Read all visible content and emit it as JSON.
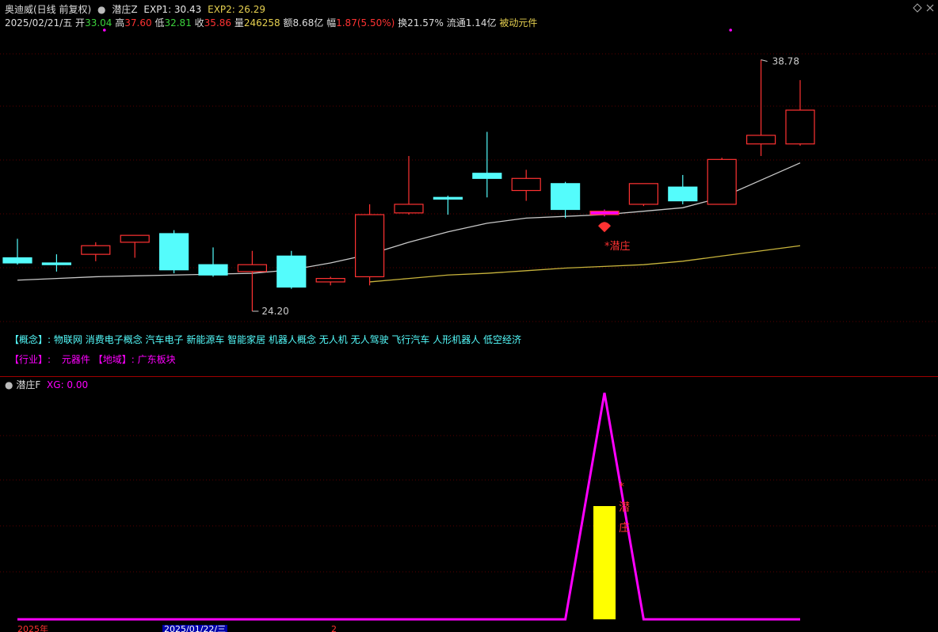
{
  "header": {
    "stock_title": "奥迪威(日线 前复权)",
    "indicator_name": "潜庄Z",
    "exp1_label": "EXP1: 30.43",
    "exp2_label": "EXP2: 26.29"
  },
  "ohlc_bar": {
    "date": "2025/02/21/五",
    "open_label": "开",
    "open": "33.04",
    "high_label": "高",
    "high": "37.60",
    "low_label": "低",
    "low": "32.81",
    "close_label": "收",
    "close": "35.86",
    "volume_label": "量",
    "volume": "246258",
    "amount_label": "额",
    "amount": "8.68亿",
    "change_label": "幅",
    "change": "1.87(5.50%)",
    "turnover_label": "换",
    "turnover": "21.57%",
    "float_label": "流通",
    "float": "1.14亿",
    "sector": "被动元件"
  },
  "info": {
    "concept_label": "【概念】:",
    "concepts": "物联网 消费电子概念 汽车电子 新能源车 智能家居 机器人概念 无人机 无人驾驶 飞行汽车 人形机器人 低空经济",
    "industry_label": "【行业】:",
    "industry": "元器件",
    "region_label": "【地域】:",
    "region": "广东板块"
  },
  "sub_header": {
    "name": "潜庄F",
    "xg_label": "XG: 0.00"
  },
  "bottom_axis": {
    "year_label": "2025年",
    "cursor_date": "2025/01/22/三",
    "marker": "2"
  },
  "colors": {
    "background": "#000000",
    "up": "#ff3232",
    "down": "#54fcfc",
    "signal": "#ff00ff",
    "ma1": "#c8c8c8",
    "ma2": "#c8b43c",
    "signal_bar": "#ffff00",
    "grid": "#5a0000"
  },
  "chart_data": [
    {
      "type": "candlestick",
      "price_range": [
        22.5,
        40.5
      ],
      "candles": [
        {
          "open": 27.3,
          "high": 28.4,
          "low": 26.9,
          "close": 27.0
        },
        {
          "open": 27.0,
          "high": 27.5,
          "low": 26.5,
          "close": 26.9
        },
        {
          "open": 27.5,
          "high": 28.2,
          "low": 27.1,
          "close": 28.0
        },
        {
          "open": 28.2,
          "high": 28.4,
          "low": 27.3,
          "close": 28.6
        },
        {
          "open": 28.7,
          "high": 28.9,
          "low": 26.4,
          "close": 26.6
        },
        {
          "open": 26.9,
          "high": 27.9,
          "low": 26.2,
          "close": 26.3
        },
        {
          "open": 26.5,
          "high": 27.7,
          "low": 24.2,
          "close": 26.9
        },
        {
          "open": 27.4,
          "high": 27.7,
          "low": 25.5,
          "close": 25.6
        },
        {
          "open": 25.9,
          "high": 26.2,
          "low": 25.7,
          "close": 26.1
        },
        {
          "open": 26.2,
          "high": 30.4,
          "low": 25.7,
          "close": 29.8
        },
        {
          "open": 29.9,
          "high": 33.2,
          "low": 29.8,
          "close": 30.4
        },
        {
          "open": 30.8,
          "high": 30.9,
          "low": 29.8,
          "close": 30.7
        },
        {
          "open": 32.2,
          "high": 34.6,
          "low": 30.8,
          "close": 31.9
        },
        {
          "open": 31.2,
          "high": 32.4,
          "low": 30.6,
          "close": 31.9
        },
        {
          "open": 31.6,
          "high": 31.7,
          "low": 29.6,
          "close": 30.1
        },
        {
          "open": 30.0,
          "high": 30.1,
          "low": 29.7,
          "close": 29.8
        },
        {
          "open": 30.4,
          "high": 31.6,
          "low": 30.3,
          "close": 31.6
        },
        {
          "open": 31.4,
          "high": 32.1,
          "low": 30.4,
          "close": 30.6
        },
        {
          "open": 30.4,
          "high": 33.1,
          "low": 30.4,
          "close": 33.0
        },
        {
          "open": 33.9,
          "high": 38.78,
          "low": 33.2,
          "close": 34.4
        },
        {
          "open": 33.9,
          "high": 37.6,
          "low": 33.8,
          "close": 35.86
        }
      ],
      "highlight_index": 15,
      "ma1": [
        26.0,
        26.1,
        26.2,
        26.25,
        26.3,
        26.35,
        26.4,
        26.6,
        27.0,
        27.5,
        28.2,
        28.8,
        29.3,
        29.6,
        29.7,
        29.8,
        30.0,
        30.2,
        30.8,
        31.8,
        32.8
      ],
      "ma2_start_index": 9,
      "ma2": [
        25.9,
        26.1,
        26.3,
        26.4,
        26.55,
        26.7,
        26.8,
        26.9,
        27.1,
        27.4,
        27.7,
        28.0
      ],
      "annotations": {
        "max_label": "38.78",
        "min_label": "24.20",
        "signal_label": "*潜庄"
      },
      "signal_dots_index": [
        2,
        18
      ]
    },
    {
      "type": "line",
      "name": "潜庄F",
      "y_range": [
        0,
        100
      ],
      "values": [
        0,
        0,
        0,
        0,
        0,
        0,
        0,
        0,
        0,
        0,
        0,
        0,
        0,
        0,
        0,
        100,
        0,
        0,
        0,
        0,
        0
      ],
      "bar_index": 15,
      "bar_value": 50,
      "bar_label": "*潜庄"
    }
  ]
}
